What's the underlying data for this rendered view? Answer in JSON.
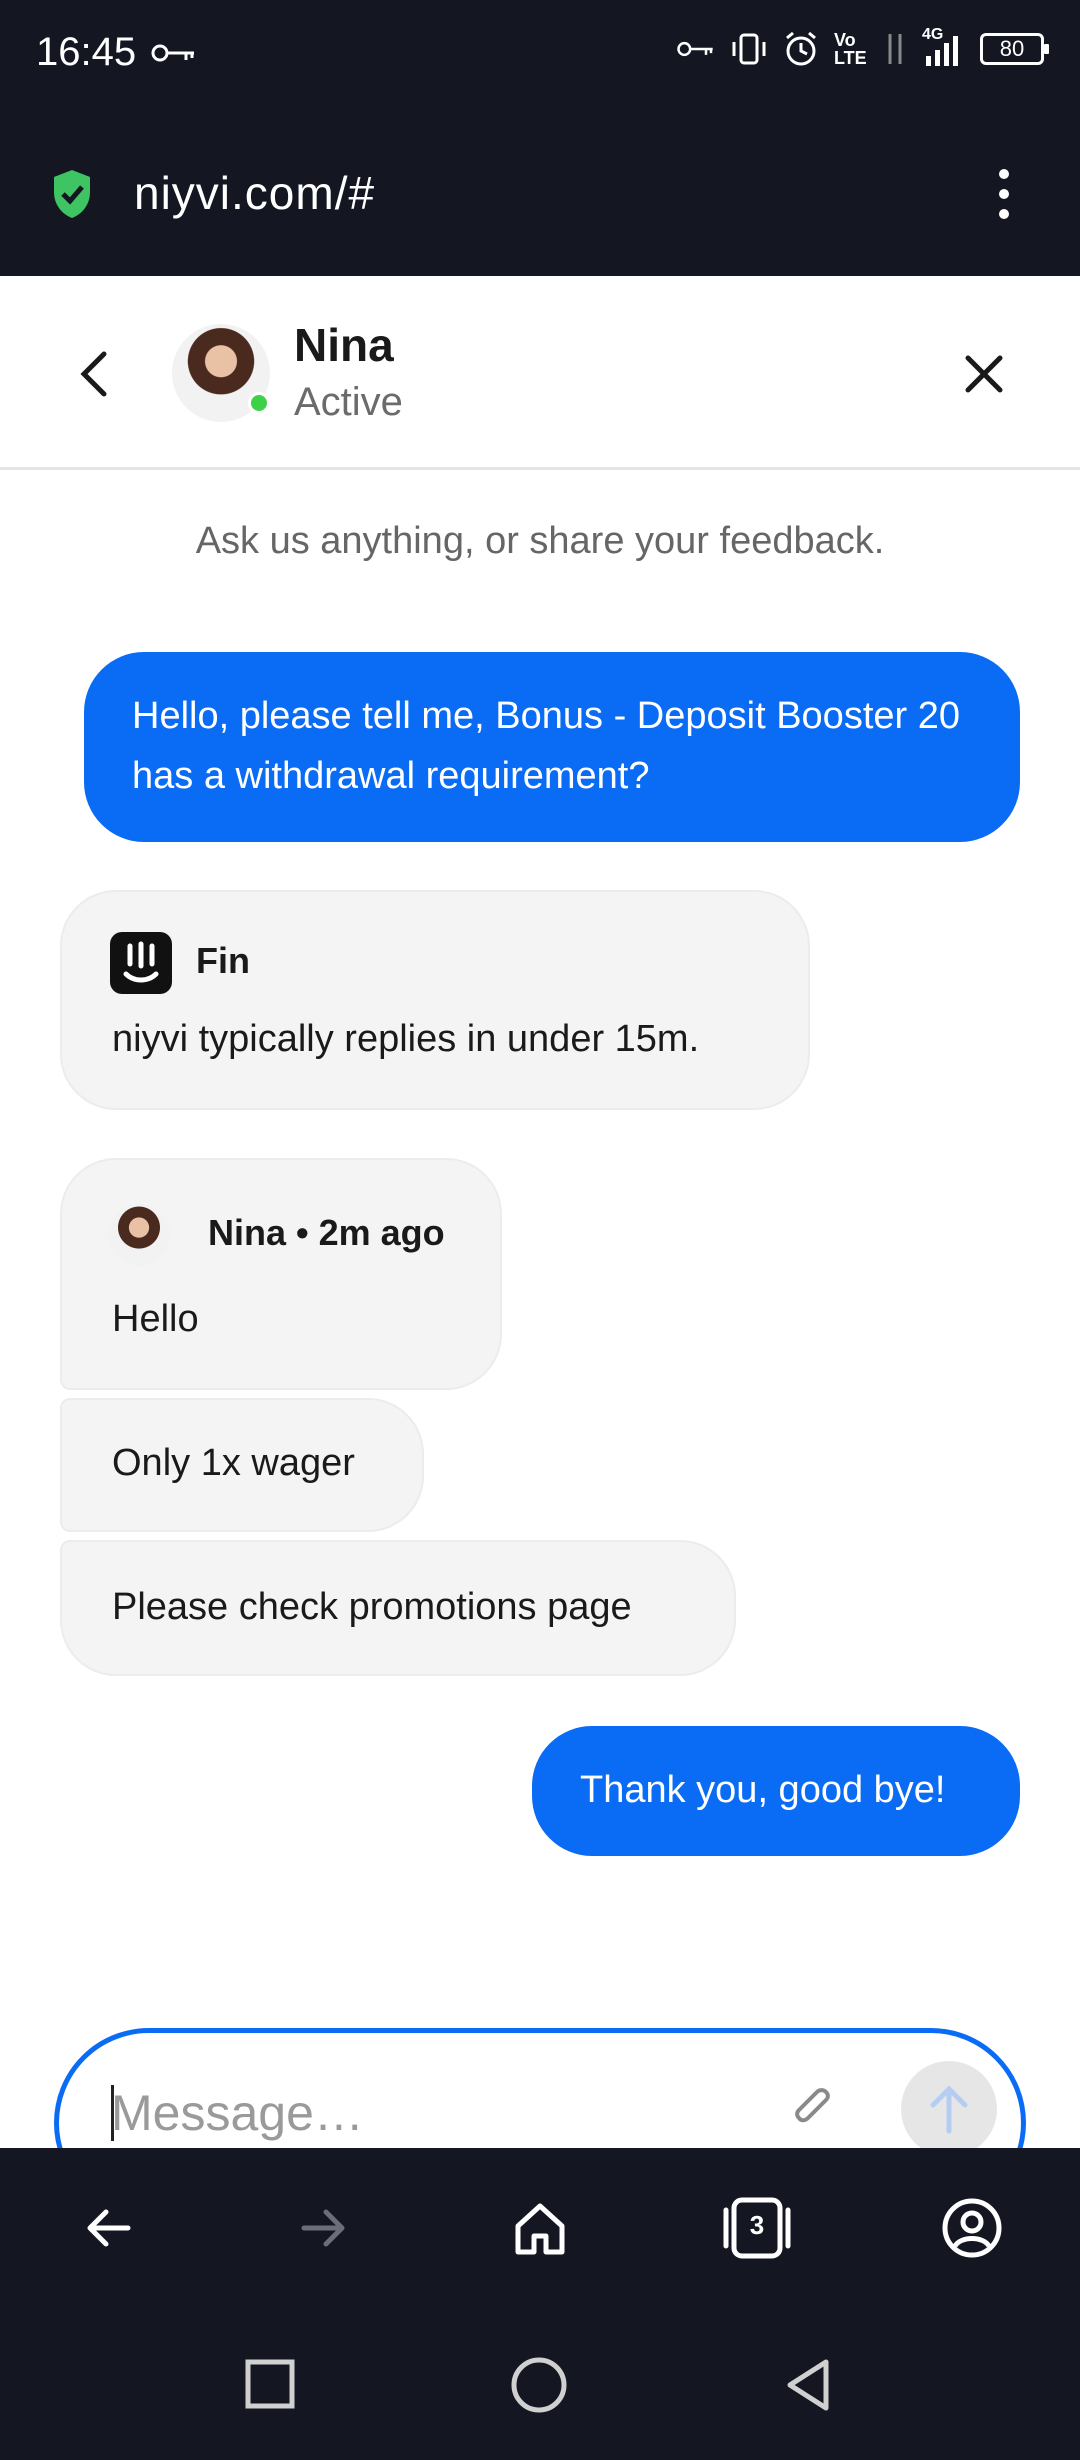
{
  "status_bar": {
    "time": "16:45",
    "network": "4G",
    "volte": "Vo LTE",
    "battery": "80"
  },
  "browser": {
    "url": "niyvi.com/#",
    "menu_icon": "more-vertical-icon",
    "tabs_count": "3"
  },
  "chat_header": {
    "agent_name": "Nina",
    "agent_status": "Active"
  },
  "intro_text": "Ask us anything, or share your feedback.",
  "messages": [
    {
      "from": "user",
      "text": "Hello, please tell me, Bonus - Deposit Booster 20 has a withdrawal requirement?"
    },
    {
      "from": "bot",
      "sender": "Fin",
      "text": "niyvi typically replies in under 15m."
    },
    {
      "from": "agent",
      "sender": "Nina • 2m ago",
      "text": "Hello"
    },
    {
      "from": "agent",
      "text": "Only 1x wager"
    },
    {
      "from": "agent",
      "text": "Please check promotions page"
    },
    {
      "from": "user",
      "text": "Thank you, good bye!"
    }
  ],
  "composer": {
    "placeholder": "Message…"
  },
  "colors": {
    "accent": "#0a6cf5",
    "dark_bar": "#141722",
    "online": "#3dd14a"
  }
}
